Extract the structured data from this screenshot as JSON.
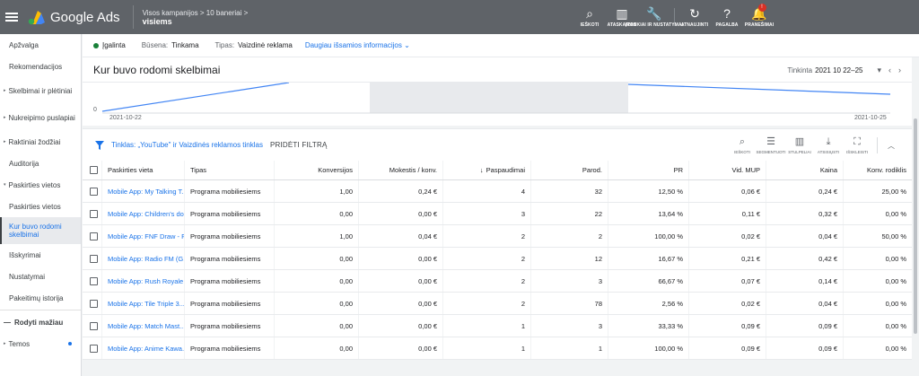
{
  "app": {
    "name": "Google Ads"
  },
  "breadcrumb": {
    "top": "Visos kampanijos  >  10 baneriai  >",
    "bottom": "visiems"
  },
  "toolbar_icons": [
    {
      "name": "search-icon",
      "glyph": "⌕",
      "label": "IEŠKOTI"
    },
    {
      "name": "reports-icon",
      "glyph": "▥",
      "label": "ATASKAITOS"
    },
    {
      "name": "tools-icon",
      "glyph": "🔧",
      "label": "ĮRANKIAI IR NUSTATYMAI"
    },
    {
      "name": "refresh-icon",
      "glyph": "↻",
      "label": "ATNAUJINTI"
    },
    {
      "name": "help-icon",
      "glyph": "?",
      "label": "PAGALBA"
    },
    {
      "name": "notifications-icon",
      "glyph": "🔔",
      "label": "PRANEŠIMAI",
      "badge": "!"
    }
  ],
  "sidebar": {
    "items": [
      {
        "label": "Apžvalga",
        "type": "plain"
      },
      {
        "label": "Rekomendacijos",
        "type": "plain"
      },
      {
        "label": "Skelbimai ir plėtiniai",
        "type": "arrow",
        "arrow": "▸"
      },
      {
        "label": "Nukreipimo puslapiai",
        "type": "arrow",
        "arrow": "▸"
      },
      {
        "label": "Raktiniai žodžiai",
        "type": "arrow",
        "arrow": "▸"
      },
      {
        "label": "Auditorija",
        "type": "plain"
      },
      {
        "label": "Paskirties vietos",
        "type": "arrow",
        "arrow": "▾"
      },
      {
        "label": "Paskirties vietos",
        "type": "sub"
      },
      {
        "label": "Kur buvo rodomi skelbimai",
        "type": "active"
      },
      {
        "label": "Išskyrimai",
        "type": "sub"
      },
      {
        "label": "Nustatymai",
        "type": "plain"
      },
      {
        "label": "Pakeitimų istorija",
        "type": "plain"
      },
      {
        "label": "Rodyti mažiau",
        "type": "less",
        "glyph": "—"
      },
      {
        "label": "Temos",
        "type": "arrow",
        "arrow": "▸",
        "dot": true
      }
    ]
  },
  "status": {
    "state": "Įgalinta",
    "status_label": "Būsena:",
    "status_value": "Tinkama",
    "type_label": "Tipas:",
    "type_value": "Vaizdinė reklama",
    "more_link": "Daugiau išsamios informacijos",
    "more_chevron": "⌄"
  },
  "page": {
    "title": "Kur buvo rodomi skelbimai"
  },
  "daterange": {
    "label": "Tinkinta",
    "value": "2021 10 22–25",
    "dropdown": "▾",
    "prev": "‹",
    "next": "›"
  },
  "chart": {
    "zero": "0",
    "start_date": "2021-10-22",
    "end_date": "2021-10-25"
  },
  "filter": {
    "text": "Tinklas: „YouTube\" ir Vaizdinės reklamos tinklas",
    "add": "PRIDĖTI FILTRĄ"
  },
  "tools": [
    {
      "name": "search-icon",
      "glyph": "⌕",
      "label": "IEŠKOTI"
    },
    {
      "name": "segment-icon",
      "glyph": "☰",
      "label": "SEGMENTUOTI"
    },
    {
      "name": "columns-icon",
      "glyph": "▥",
      "label": "STULPELIAI"
    },
    {
      "name": "download-icon",
      "glyph": "⤓",
      "label": "ATSISIŲSTI"
    },
    {
      "name": "expand-icon",
      "glyph": "⛶",
      "label": "IŠSKLEISTI"
    }
  ],
  "collapse_glyph": "︿",
  "table": {
    "headers": [
      "Paskirties vieta",
      "Tipas",
      "Konversijos",
      "Mokestis / konv.",
      "Paspaudimai",
      "Parod.",
      "PR",
      "Vid. MUP",
      "Kaina",
      "Konv. rodiklis"
    ],
    "sort_arrow": "↓",
    "rows": [
      [
        "Mobile App: My Talking T...",
        "Programa mobiliesiems",
        "1,00",
        "0,24 €",
        "4",
        "32",
        "12,50 %",
        "0,06 €",
        "0,24 €",
        "25,00 %"
      ],
      [
        "Mobile App: Children's do...",
        "Programa mobiliesiems",
        "0,00",
        "0,00 €",
        "3",
        "22",
        "13,64 %",
        "0,11 €",
        "0,32 €",
        "0,00 %"
      ],
      [
        "Mobile App: FNF Draw - F...",
        "Programa mobiliesiems",
        "1,00",
        "0,04 €",
        "2",
        "2",
        "100,00 %",
        "0,02 €",
        "0,04 €",
        "50,00 %"
      ],
      [
        "Mobile App: Radio FM (G...",
        "Programa mobiliesiems",
        "0,00",
        "0,00 €",
        "2",
        "12",
        "16,67 %",
        "0,21 €",
        "0,42 €",
        "0,00 %"
      ],
      [
        "Mobile App: Rush Royale ...",
        "Programa mobiliesiems",
        "0,00",
        "0,00 €",
        "2",
        "3",
        "66,67 %",
        "0,07 €",
        "0,14 €",
        "0,00 %"
      ],
      [
        "Mobile App: Tile Triple 3...",
        "Programa mobiliesiems",
        "0,00",
        "0,00 €",
        "2",
        "78",
        "2,56 %",
        "0,02 €",
        "0,04 €",
        "0,00 %"
      ],
      [
        "Mobile App: Match Mast...",
        "Programa mobiliesiems",
        "0,00",
        "0,00 €",
        "1",
        "3",
        "33,33 %",
        "0,09 €",
        "0,09 €",
        "0,00 %"
      ],
      [
        "Mobile App: Anime Kawa...",
        "Programa mobiliesiems",
        "0,00",
        "0,00 €",
        "1",
        "1",
        "100,00 %",
        "0,09 €",
        "0,09 €",
        "0,00 %"
      ]
    ]
  },
  "colors": {
    "topbar": "#5f6368",
    "link": "#1a73e8",
    "enabled": "#188038",
    "line": "#4285f4"
  }
}
